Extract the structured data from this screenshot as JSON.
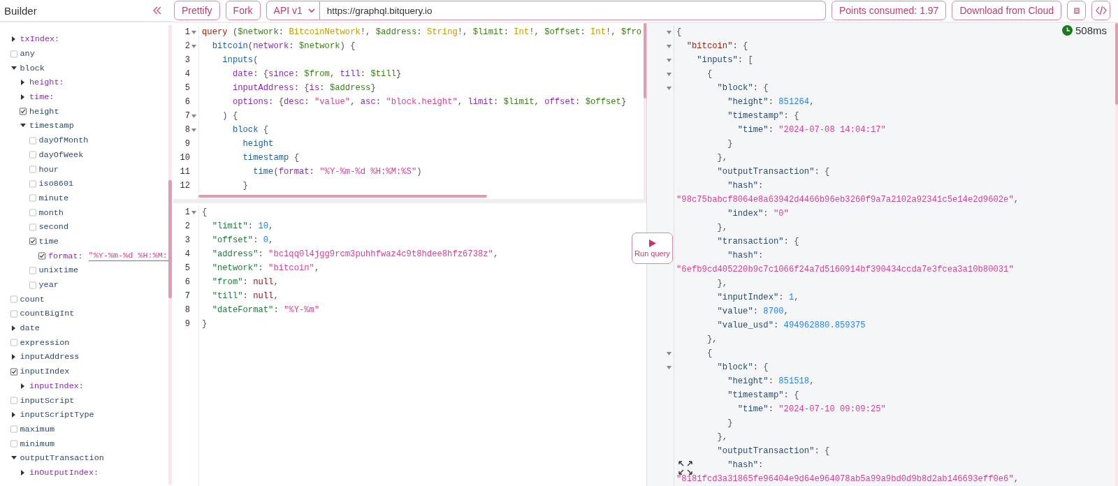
{
  "sidebar": {
    "title": "Builder",
    "tree": [
      {
        "kind": "arg",
        "label": "txIndex:",
        "expanded": false
      },
      {
        "kind": "field",
        "label": "any",
        "checked": false
      },
      {
        "kind": "object",
        "label": "block",
        "expanded": true,
        "children": [
          {
            "kind": "arg",
            "label": "height:",
            "expanded": false
          },
          {
            "kind": "arg",
            "label": "time:",
            "expanded": false
          },
          {
            "kind": "field",
            "label": "height",
            "checked": true
          },
          {
            "kind": "object",
            "label": "timestamp",
            "expanded": true,
            "children": [
              {
                "kind": "field",
                "label": "dayOfMonth",
                "checked": false
              },
              {
                "kind": "field",
                "label": "dayOfWeek",
                "checked": false
              },
              {
                "kind": "field",
                "label": "hour",
                "checked": false
              },
              {
                "kind": "field",
                "label": "iso8601",
                "checked": false
              },
              {
                "kind": "field",
                "label": "minute",
                "checked": false
              },
              {
                "kind": "field",
                "label": "month",
                "checked": false
              },
              {
                "kind": "field",
                "label": "second",
                "checked": false
              },
              {
                "kind": "field",
                "label": "time",
                "checked": true,
                "children": [
                  {
                    "kind": "arg_value",
                    "label": "format:",
                    "checked": true,
                    "value": "\"%Y-%m-%d %H:%M:"
                  }
                ]
              },
              {
                "kind": "field",
                "label": "unixtime",
                "checked": false
              },
              {
                "kind": "field",
                "label": "year",
                "checked": false
              }
            ]
          }
        ]
      },
      {
        "kind": "field",
        "label": "count",
        "checked": false
      },
      {
        "kind": "field",
        "label": "countBigInt",
        "checked": false
      },
      {
        "kind": "object",
        "label": "date",
        "expanded": false
      },
      {
        "kind": "field",
        "label": "expression",
        "checked": false
      },
      {
        "kind": "object",
        "label": "inputAddress",
        "expanded": false
      },
      {
        "kind": "field",
        "label": "inputIndex",
        "checked": true,
        "children": [
          {
            "kind": "arg",
            "label": "inputIndex:",
            "expanded": false
          }
        ]
      },
      {
        "kind": "field",
        "label": "inputScript",
        "checked": false
      },
      {
        "kind": "object",
        "label": "inputScriptType",
        "expanded": false
      },
      {
        "kind": "field",
        "label": "maximum",
        "checked": false
      },
      {
        "kind": "field",
        "label": "minimum",
        "checked": false
      },
      {
        "kind": "object",
        "label": "outputTransaction",
        "expanded": true,
        "children": [
          {
            "kind": "arg",
            "label": "inOutputIndex:",
            "expanded": false
          }
        ]
      }
    ]
  },
  "toolbar": {
    "prettify": "Prettify",
    "fork": "Fork",
    "api_version": "API v1",
    "url": "https://graphql.bitquery.io",
    "points": "Points consumed: 1.97",
    "download": "Download from Cloud"
  },
  "query_editor": {
    "lines": [
      {
        "number": "1",
        "foldable": true,
        "tokens": [
          {
            "kind": "kw",
            "text": "query"
          },
          {
            "kind": "punct",
            "text": " ("
          },
          {
            "kind": "var",
            "text": "$network"
          },
          {
            "kind": "punct",
            "text": ": "
          },
          {
            "kind": "type",
            "text": "BitcoinNetwork"
          },
          {
            "kind": "punct",
            "text": "!, "
          },
          {
            "kind": "var",
            "text": "$address"
          },
          {
            "kind": "punct",
            "text": ": "
          },
          {
            "kind": "type",
            "text": "String"
          },
          {
            "kind": "punct",
            "text": "!, "
          },
          {
            "kind": "var",
            "text": "$limit"
          },
          {
            "kind": "punct",
            "text": ": "
          },
          {
            "kind": "type",
            "text": "Int"
          },
          {
            "kind": "punct",
            "text": "!, "
          },
          {
            "kind": "var",
            "text": "$offset"
          },
          {
            "kind": "punct",
            "text": ": "
          },
          {
            "kind": "type",
            "text": "Int"
          },
          {
            "kind": "punct",
            "text": "!, "
          },
          {
            "kind": "var",
            "text": "$fro"
          }
        ]
      },
      {
        "number": "2",
        "foldable": true,
        "tokens": [
          {
            "kind": "field",
            "text": "  bitcoin"
          },
          {
            "kind": "punct",
            "text": "("
          },
          {
            "kind": "arg",
            "text": "network"
          },
          {
            "kind": "punct",
            "text": ": "
          },
          {
            "kind": "var",
            "text": "$network"
          },
          {
            "kind": "punct",
            "text": ") {"
          }
        ]
      },
      {
        "number": "3",
        "foldable": false,
        "tokens": [
          {
            "kind": "field",
            "text": "    inputs"
          },
          {
            "kind": "punct",
            "text": "("
          }
        ]
      },
      {
        "number": "4",
        "foldable": false,
        "tokens": [
          {
            "kind": "arg",
            "text": "      date"
          },
          {
            "kind": "punct",
            "text": ": {"
          },
          {
            "kind": "arg",
            "text": "since"
          },
          {
            "kind": "punct",
            "text": ": "
          },
          {
            "kind": "var",
            "text": "$from"
          },
          {
            "kind": "punct",
            "text": ", "
          },
          {
            "kind": "arg",
            "text": "till"
          },
          {
            "kind": "punct",
            "text": ": "
          },
          {
            "kind": "var",
            "text": "$till"
          },
          {
            "kind": "punct",
            "text": "}"
          }
        ]
      },
      {
        "number": "5",
        "foldable": false,
        "tokens": [
          {
            "kind": "arg",
            "text": "      inputAddress"
          },
          {
            "kind": "punct",
            "text": ": {"
          },
          {
            "kind": "arg",
            "text": "is"
          },
          {
            "kind": "punct",
            "text": ": "
          },
          {
            "kind": "var",
            "text": "$address"
          },
          {
            "kind": "punct",
            "text": "}"
          }
        ]
      },
      {
        "number": "6",
        "foldable": false,
        "tokens": [
          {
            "kind": "arg",
            "text": "      options"
          },
          {
            "kind": "punct",
            "text": ": {"
          },
          {
            "kind": "arg",
            "text": "desc"
          },
          {
            "kind": "punct",
            "text": ": "
          },
          {
            "kind": "str",
            "text": "\"value\""
          },
          {
            "kind": "punct",
            "text": ", "
          },
          {
            "kind": "arg",
            "text": "asc"
          },
          {
            "kind": "punct",
            "text": ": "
          },
          {
            "kind": "str",
            "text": "\"block.height\""
          },
          {
            "kind": "punct",
            "text": ", "
          },
          {
            "kind": "arg",
            "text": "limit"
          },
          {
            "kind": "punct",
            "text": ": "
          },
          {
            "kind": "var",
            "text": "$limit"
          },
          {
            "kind": "punct",
            "text": ", "
          },
          {
            "kind": "arg",
            "text": "offset"
          },
          {
            "kind": "punct",
            "text": ": "
          },
          {
            "kind": "var",
            "text": "$offset"
          },
          {
            "kind": "punct",
            "text": "}"
          }
        ]
      },
      {
        "number": "7",
        "foldable": true,
        "tokens": [
          {
            "kind": "punct",
            "text": "    ) {"
          }
        ]
      },
      {
        "number": "8",
        "foldable": true,
        "tokens": [
          {
            "kind": "field",
            "text": "      block"
          },
          {
            "kind": "punct",
            "text": " {"
          }
        ]
      },
      {
        "number": "9",
        "foldable": false,
        "tokens": [
          {
            "kind": "field",
            "text": "        height"
          }
        ]
      },
      {
        "number": "10",
        "foldable": false,
        "tokens": [
          {
            "kind": "field",
            "text": "        timestamp"
          },
          {
            "kind": "punct",
            "text": " {"
          }
        ]
      },
      {
        "number": "11",
        "foldable": false,
        "tokens": [
          {
            "kind": "field",
            "text": "          time"
          },
          {
            "kind": "punct",
            "text": "("
          },
          {
            "kind": "arg",
            "text": "format"
          },
          {
            "kind": "punct",
            "text": ": "
          },
          {
            "kind": "str",
            "text": "\"%Y-%m-%d %H:%M:%S\""
          },
          {
            "kind": "punct",
            "text": ")"
          }
        ]
      },
      {
        "number": "12",
        "foldable": false,
        "tokens": [
          {
            "kind": "punct",
            "text": "        }"
          }
        ]
      }
    ]
  },
  "variables_editor": {
    "lines": [
      {
        "number": "1",
        "foldable": true,
        "tokens": [
          {
            "kind": "punct",
            "text": "{"
          }
        ]
      },
      {
        "number": "2",
        "foldable": false,
        "tokens": [
          {
            "kind": "vkey",
            "text": "  \"limit\""
          },
          {
            "kind": "punct",
            "text": ": "
          },
          {
            "kind": "num",
            "text": "10"
          },
          {
            "kind": "punct",
            "text": ","
          }
        ]
      },
      {
        "number": "3",
        "foldable": false,
        "tokens": [
          {
            "kind": "vkey",
            "text": "  \"offset\""
          },
          {
            "kind": "punct",
            "text": ": "
          },
          {
            "kind": "num",
            "text": "0"
          },
          {
            "kind": "punct",
            "text": ","
          }
        ]
      },
      {
        "number": "4",
        "foldable": false,
        "tokens": [
          {
            "kind": "vkey",
            "text": "  \"address\""
          },
          {
            "kind": "punct",
            "text": ": "
          },
          {
            "kind": "str",
            "text": "\"bc1qq0l4jgg9rcm3puhhfwaz4c9t8hdee8hfz6738z\""
          },
          {
            "kind": "punct",
            "text": ","
          }
        ]
      },
      {
        "number": "5",
        "foldable": false,
        "tokens": [
          {
            "kind": "vkey",
            "text": "  \"network\""
          },
          {
            "kind": "punct",
            "text": ": "
          },
          {
            "kind": "str",
            "text": "\"bitcoin\""
          },
          {
            "kind": "punct",
            "text": ","
          }
        ]
      },
      {
        "number": "6",
        "foldable": false,
        "tokens": [
          {
            "kind": "vkey",
            "text": "  \"from\""
          },
          {
            "kind": "punct",
            "text": ": "
          },
          {
            "kind": "null",
            "text": "null"
          },
          {
            "kind": "punct",
            "text": ","
          }
        ]
      },
      {
        "number": "7",
        "foldable": false,
        "tokens": [
          {
            "kind": "vkey",
            "text": "  \"till\""
          },
          {
            "kind": "punct",
            "text": ": "
          },
          {
            "kind": "null",
            "text": "null"
          },
          {
            "kind": "punct",
            "text": ","
          }
        ]
      },
      {
        "number": "8",
        "foldable": false,
        "tokens": [
          {
            "kind": "vkey",
            "text": "  \"dateFormat\""
          },
          {
            "kind": "punct",
            "text": ": "
          },
          {
            "kind": "str",
            "text": "\"%Y-%m\""
          }
        ]
      },
      {
        "number": "9",
        "foldable": false,
        "tokens": [
          {
            "kind": "punct",
            "text": "}"
          }
        ]
      }
    ]
  },
  "run_button": {
    "label": "Run query"
  },
  "result": {
    "duration": "508ms",
    "lines": [
      {
        "foldable": true,
        "tokens": [
          {
            "kind": "punct",
            "text": "{"
          }
        ]
      },
      {
        "foldable": true,
        "tokens": [
          {
            "kind": "rootkey",
            "text": "  \"bitcoin\""
          },
          {
            "kind": "punct",
            "text": ": {"
          }
        ]
      },
      {
        "foldable": true,
        "tokens": [
          {
            "kind": "key",
            "text": "    \"inputs\""
          },
          {
            "kind": "punct",
            "text": ": ["
          }
        ]
      },
      {
        "foldable": true,
        "tokens": [
          {
            "kind": "punct",
            "text": "      {"
          }
        ]
      },
      {
        "foldable": true,
        "tokens": [
          {
            "kind": "key",
            "text": "        \"block\""
          },
          {
            "kind": "punct",
            "text": ": {"
          }
        ]
      },
      {
        "foldable": false,
        "tokens": [
          {
            "kind": "key",
            "text": "          \"height\""
          },
          {
            "kind": "punct",
            "text": ": "
          },
          {
            "kind": "num",
            "text": "851264"
          },
          {
            "kind": "punct",
            "text": ","
          }
        ]
      },
      {
        "foldable": false,
        "tokens": [
          {
            "kind": "key",
            "text": "          \"timestamp\""
          },
          {
            "kind": "punct",
            "text": ": {"
          }
        ]
      },
      {
        "foldable": false,
        "tokens": [
          {
            "kind": "key",
            "text": "            \"time\""
          },
          {
            "kind": "punct",
            "text": ": "
          },
          {
            "kind": "str",
            "text": "\"2024-07-08 14:04:17\""
          }
        ]
      },
      {
        "foldable": false,
        "tokens": [
          {
            "kind": "punct",
            "text": "          }"
          }
        ]
      },
      {
        "foldable": false,
        "tokens": [
          {
            "kind": "punct",
            "text": "        },"
          }
        ]
      },
      {
        "foldable": false,
        "tokens": [
          {
            "kind": "key",
            "text": "        \"outputTransaction\""
          },
          {
            "kind": "punct",
            "text": ": {"
          }
        ]
      },
      {
        "foldable": false,
        "tokens": [
          {
            "kind": "key",
            "text": "          \"hash\""
          },
          {
            "kind": "punct",
            "text": ":"
          }
        ]
      },
      {
        "foldable": false,
        "tokens": [
          {
            "kind": "str",
            "text": "\"98c75babcf8064e8a63942d4466b96eb3260f9a7a2102a92341c5e14e2d9602e\""
          },
          {
            "kind": "punct",
            "text": ","
          }
        ]
      },
      {
        "foldable": false,
        "tokens": [
          {
            "kind": "key",
            "text": "          \"index\""
          },
          {
            "kind": "punct",
            "text": ": "
          },
          {
            "kind": "str",
            "text": "\"0\""
          }
        ]
      },
      {
        "foldable": false,
        "tokens": [
          {
            "kind": "punct",
            "text": "        },"
          }
        ]
      },
      {
        "foldable": false,
        "tokens": [
          {
            "kind": "key",
            "text": "        \"transaction\""
          },
          {
            "kind": "punct",
            "text": ": {"
          }
        ]
      },
      {
        "foldable": false,
        "tokens": [
          {
            "kind": "key",
            "text": "          \"hash\""
          },
          {
            "kind": "punct",
            "text": ":"
          }
        ]
      },
      {
        "foldable": false,
        "tokens": [
          {
            "kind": "str",
            "text": "\"6efb9cd405220b9c7c1066f24a7d5160914bf390434ccda7e3fcea3a10b80031\""
          }
        ]
      },
      {
        "foldable": false,
        "tokens": [
          {
            "kind": "punct",
            "text": "        },"
          }
        ]
      },
      {
        "foldable": false,
        "tokens": [
          {
            "kind": "key",
            "text": "        \"inputIndex\""
          },
          {
            "kind": "punct",
            "text": ": "
          },
          {
            "kind": "num",
            "text": "1"
          },
          {
            "kind": "punct",
            "text": ","
          }
        ]
      },
      {
        "foldable": false,
        "tokens": [
          {
            "kind": "key",
            "text": "        \"value\""
          },
          {
            "kind": "punct",
            "text": ": "
          },
          {
            "kind": "num",
            "text": "8700"
          },
          {
            "kind": "punct",
            "text": ","
          }
        ]
      },
      {
        "foldable": false,
        "tokens": [
          {
            "kind": "key",
            "text": "        \"value_usd\""
          },
          {
            "kind": "punct",
            "text": ": "
          },
          {
            "kind": "num",
            "text": "494962880.859375"
          }
        ]
      },
      {
        "foldable": false,
        "tokens": [
          {
            "kind": "punct",
            "text": "      },"
          }
        ]
      },
      {
        "foldable": true,
        "tokens": [
          {
            "kind": "punct",
            "text": "      {"
          }
        ]
      },
      {
        "foldable": true,
        "tokens": [
          {
            "kind": "key",
            "text": "        \"block\""
          },
          {
            "kind": "punct",
            "text": ": {"
          }
        ]
      },
      {
        "foldable": false,
        "tokens": [
          {
            "kind": "key",
            "text": "          \"height\""
          },
          {
            "kind": "punct",
            "text": ": "
          },
          {
            "kind": "num",
            "text": "851518"
          },
          {
            "kind": "punct",
            "text": ","
          }
        ]
      },
      {
        "foldable": false,
        "tokens": [
          {
            "kind": "key",
            "text": "          \"timestamp\""
          },
          {
            "kind": "punct",
            "text": ": {"
          }
        ]
      },
      {
        "foldable": false,
        "tokens": [
          {
            "kind": "key",
            "text": "            \"time\""
          },
          {
            "kind": "punct",
            "text": ": "
          },
          {
            "kind": "str",
            "text": "\"2024-07-10 09:09:25\""
          }
        ]
      },
      {
        "foldable": false,
        "tokens": [
          {
            "kind": "punct",
            "text": "          }"
          }
        ]
      },
      {
        "foldable": false,
        "tokens": [
          {
            "kind": "punct",
            "text": "        },"
          }
        ]
      },
      {
        "foldable": false,
        "tokens": [
          {
            "kind": "key",
            "text": "        \"outputTransaction\""
          },
          {
            "kind": "punct",
            "text": ": {"
          }
        ]
      },
      {
        "foldable": false,
        "tokens": [
          {
            "kind": "key",
            "text": "          \"hash\""
          },
          {
            "kind": "punct",
            "text": ":"
          }
        ]
      },
      {
        "foldable": false,
        "tokens": [
          {
            "kind": "str",
            "text": "\"8181fcd3a31865fe96404e9d64e964078ab5a99a9bd0d9b8d2ab146693eff0e6\""
          },
          {
            "kind": "punct",
            "text": ","
          }
        ]
      }
    ]
  }
}
